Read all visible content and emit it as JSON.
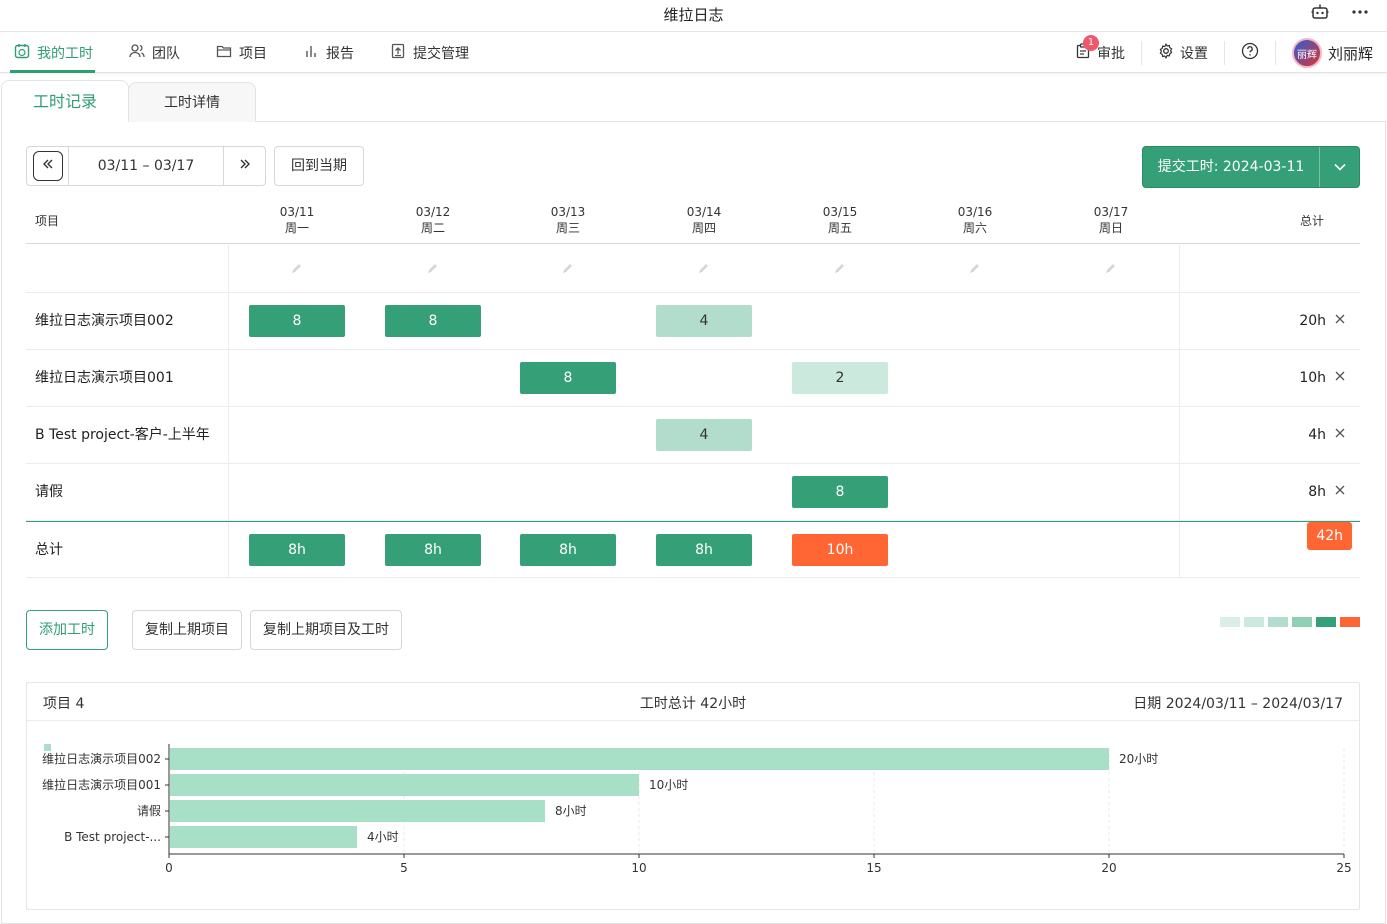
{
  "window": {
    "title": "维拉日志"
  },
  "nav": {
    "items": [
      {
        "label": "我的工时",
        "active": true
      },
      {
        "label": "团队"
      },
      {
        "label": "项目"
      },
      {
        "label": "报告"
      },
      {
        "label": "提交管理"
      }
    ],
    "approval_label": "审批",
    "approval_badge": "1",
    "settings_label": "设置",
    "avatar_text": "丽辉",
    "user_name": "刘丽辉"
  },
  "tabs": [
    {
      "label": "工时记录",
      "active": true
    },
    {
      "label": "工时详情"
    }
  ],
  "toolbar": {
    "range": "03/11 – 03/17",
    "current_label": "回到当期",
    "submit_label": "提交工时: 2024-03-11"
  },
  "grid": {
    "project_header": "项目",
    "total_header": "总计",
    "days": [
      {
        "date": "03/11",
        "week": "周一"
      },
      {
        "date": "03/12",
        "week": "周二"
      },
      {
        "date": "03/13",
        "week": "周三"
      },
      {
        "date": "03/14",
        "week": "周四"
      },
      {
        "date": "03/15",
        "week": "周五"
      },
      {
        "date": "03/16",
        "week": "周六"
      },
      {
        "date": "03/17",
        "week": "周日"
      }
    ],
    "rows": [
      {
        "name": "维拉日志演示项目002",
        "hours": [
          "8",
          "8",
          "",
          "4",
          "",
          "",
          ""
        ],
        "total": "20h"
      },
      {
        "name": "维拉日志演示项目001",
        "hours": [
          "",
          "",
          "8",
          "",
          "2",
          "",
          ""
        ],
        "total": "10h"
      },
      {
        "name": "B Test project-客户-上半年",
        "hours": [
          "",
          "",
          "",
          "4",
          "",
          "",
          ""
        ],
        "total": "4h"
      },
      {
        "name": "请假",
        "hours": [
          "",
          "",
          "",
          "",
          "8",
          "",
          ""
        ],
        "total": "8h"
      }
    ],
    "total_row": {
      "label": "总计",
      "values": [
        "8h",
        "8h",
        "8h",
        "8h",
        "10h",
        "",
        ""
      ],
      "total": "42h"
    }
  },
  "actions": {
    "add_label": "添加工时",
    "copy_projects_label": "复制上期项目",
    "copy_projects_hours_label": "复制上期项目及工时"
  },
  "legend_colors": [
    "#daeee6",
    "#cbe9dd",
    "#b2ddcc",
    "#8fd0b5",
    "#35a077",
    "#ff6633"
  ],
  "colors": {
    "accent": "#35a077",
    "over": "#ff6633",
    "bar": "#a8dfc7"
  },
  "summary": {
    "projects": "项目 4",
    "total": "工时总计 42小时",
    "date": "日期 2024/03/11 – 2024/03/17"
  },
  "chart_data": {
    "type": "bar",
    "orientation": "horizontal",
    "categories": [
      "维拉日志演示项目002",
      "维拉日志演示项目001",
      "请假",
      "B Test project-..."
    ],
    "values": [
      20,
      10,
      8,
      4
    ],
    "value_labels": [
      "20小时",
      "10小时",
      "8小时",
      "4小时"
    ],
    "xlim": [
      0,
      25
    ],
    "xticks": [
      0,
      5,
      10,
      15,
      20,
      25
    ],
    "grid": true
  }
}
